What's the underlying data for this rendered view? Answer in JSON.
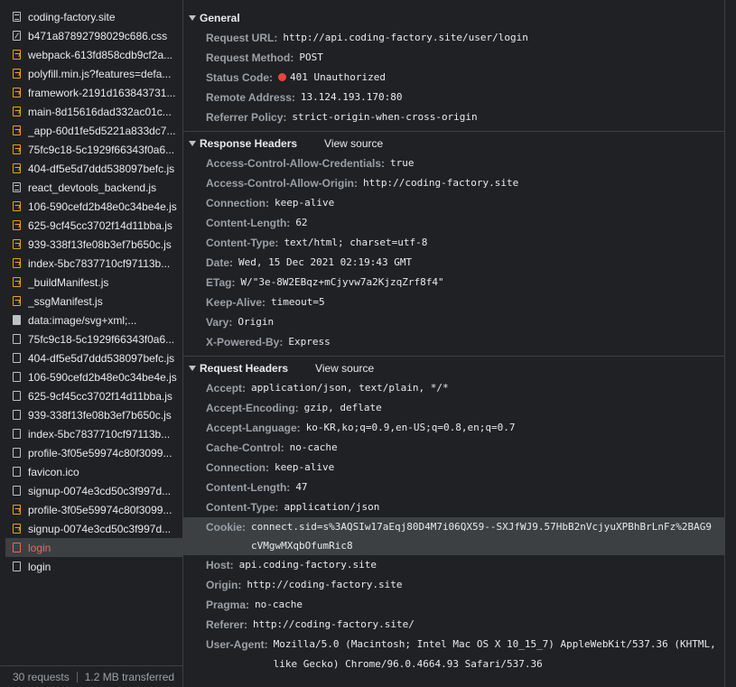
{
  "requests": [
    {
      "name": "coding-factory.site",
      "icon": "document-icon",
      "kind": "doc"
    },
    {
      "name": "b471a87892798029c686.css",
      "icon": "stylesheet-icon",
      "kind": "css"
    },
    {
      "name": "webpack-613fd858cdb9cf2a...",
      "icon": "script-icon",
      "kind": "js"
    },
    {
      "name": "polyfill.min.js?features=defa...",
      "icon": "script-icon",
      "kind": "js"
    },
    {
      "name": "framework-2191d163843731...",
      "icon": "script-icon",
      "kind": "js"
    },
    {
      "name": "main-8d15616dad332ac01c...",
      "icon": "script-icon",
      "kind": "js"
    },
    {
      "name": "_app-60d1fe5d5221a833dc7...",
      "icon": "script-icon",
      "kind": "js"
    },
    {
      "name": "75fc9c18-5c1929f66343f0a6...",
      "icon": "script-icon",
      "kind": "js"
    },
    {
      "name": "404-df5e5d7ddd538097befc.js",
      "icon": "script-icon",
      "kind": "js"
    },
    {
      "name": "react_devtools_backend.js",
      "icon": "file-icon",
      "kind": "doc"
    },
    {
      "name": "106-590cefd2b48e0c34be4e.js",
      "icon": "script-icon",
      "kind": "js"
    },
    {
      "name": "625-9cf45cc3702f14d11bba.js",
      "icon": "script-icon",
      "kind": "js"
    },
    {
      "name": "939-338f13fe08b3ef7b650c.js",
      "icon": "script-icon",
      "kind": "js"
    },
    {
      "name": "index-5bc7837710cf97113b...",
      "icon": "script-icon",
      "kind": "js"
    },
    {
      "name": "_buildManifest.js",
      "icon": "script-icon",
      "kind": "js"
    },
    {
      "name": "_ssgManifest.js",
      "icon": "script-icon",
      "kind": "js"
    },
    {
      "name": "data:image/svg+xml;...",
      "icon": "image-icon",
      "kind": "img"
    },
    {
      "name": "75fc9c18-5c1929f66343f0a6...",
      "icon": "file-icon",
      "kind": "plain"
    },
    {
      "name": "404-df5e5d7ddd538097befc.js",
      "icon": "file-icon",
      "kind": "plain"
    },
    {
      "name": "106-590cefd2b48e0c34be4e.js",
      "icon": "file-icon",
      "kind": "plain"
    },
    {
      "name": "625-9cf45cc3702f14d11bba.js",
      "icon": "file-icon",
      "kind": "plain"
    },
    {
      "name": "939-338f13fe08b3ef7b650c.js",
      "icon": "file-icon",
      "kind": "plain"
    },
    {
      "name": "index-5bc7837710cf97113b...",
      "icon": "file-icon",
      "kind": "plain"
    },
    {
      "name": "profile-3f05e59974c80f3099...",
      "icon": "file-icon",
      "kind": "plain"
    },
    {
      "name": "favicon.ico",
      "icon": "file-icon",
      "kind": "plain"
    },
    {
      "name": "signup-0074e3cd50c3f997d...",
      "icon": "file-icon",
      "kind": "plain"
    },
    {
      "name": "profile-3f05e59974c80f3099...",
      "icon": "script-icon",
      "kind": "js"
    },
    {
      "name": "signup-0074e3cd50c3f997d...",
      "icon": "script-icon",
      "kind": "js"
    },
    {
      "name": "login",
      "icon": "file-icon",
      "kind": "plain",
      "state": "error-selected"
    },
    {
      "name": "login",
      "icon": "file-icon",
      "kind": "plain"
    }
  ],
  "status_bar": {
    "requests": "30 requests",
    "transferred": "1.2 MB transferred"
  },
  "general": {
    "title": "General",
    "rows": [
      {
        "key": "Request URL:",
        "value": "http://api.coding-factory.site/user/login"
      },
      {
        "key": "Request Method:",
        "value": "POST"
      },
      {
        "key": "Status Code:",
        "value": "401 Unauthorized",
        "status_dot": true
      },
      {
        "key": "Remote Address:",
        "value": "13.124.193.170:80"
      },
      {
        "key": "Referrer Policy:",
        "value": "strict-origin-when-cross-origin"
      }
    ]
  },
  "response_headers": {
    "title": "Response Headers",
    "view_source": "View source",
    "rows": [
      {
        "key": "Access-Control-Allow-Credentials:",
        "value": "true"
      },
      {
        "key": "Access-Control-Allow-Origin:",
        "value": "http://coding-factory.site"
      },
      {
        "key": "Connection:",
        "value": "keep-alive"
      },
      {
        "key": "Content-Length:",
        "value": "62"
      },
      {
        "key": "Content-Type:",
        "value": "text/html; charset=utf-8"
      },
      {
        "key": "Date:",
        "value": "Wed, 15 Dec 2021 02:19:43 GMT"
      },
      {
        "key": "ETag:",
        "value": "W/\"3e-8W2EBqz+mCjyvw7a2KjzqZrf8f4\""
      },
      {
        "key": "Keep-Alive:",
        "value": "timeout=5"
      },
      {
        "key": "Vary:",
        "value": "Origin"
      },
      {
        "key": "X-Powered-By:",
        "value": "Express"
      }
    ]
  },
  "request_headers": {
    "title": "Request Headers",
    "view_source": "View source",
    "rows": [
      {
        "key": "Accept:",
        "value": "application/json, text/plain, */*"
      },
      {
        "key": "Accept-Encoding:",
        "value": "gzip, deflate"
      },
      {
        "key": "Accept-Language:",
        "value": "ko-KR,ko;q=0.9,en-US;q=0.8,en;q=0.7"
      },
      {
        "key": "Cache-Control:",
        "value": "no-cache"
      },
      {
        "key": "Connection:",
        "value": "keep-alive"
      },
      {
        "key": "Content-Length:",
        "value": "47"
      },
      {
        "key": "Content-Type:",
        "value": "application/json"
      },
      {
        "key": "Cookie:",
        "value": "connect.sid=s%3AQSIw17aEqj80D4M7i06QX59--SXJfWJ9.57HbB2nVcjyuXPBhBrLnFz%2BAG9cVMgwMXqbOfumRic8",
        "highlight": true
      },
      {
        "key": "Host:",
        "value": "api.coding-factory.site"
      },
      {
        "key": "Origin:",
        "value": "http://coding-factory.site"
      },
      {
        "key": "Pragma:",
        "value": "no-cache"
      },
      {
        "key": "Referer:",
        "value": "http://coding-factory.site/"
      },
      {
        "key": "User-Agent:",
        "value": "Mozilla/5.0 (Macintosh; Intel Mac OS X 10_15_7) AppleWebKit/537.36 (KHTML, like Gecko) Chrome/96.0.4664.93 Safari/537.36"
      }
    ]
  },
  "colors": {
    "background": "#202124",
    "error": "#ee675c",
    "status_dot": "#e8453c",
    "js_icon": "#e8a317",
    "selected_row": "#3c4043"
  }
}
